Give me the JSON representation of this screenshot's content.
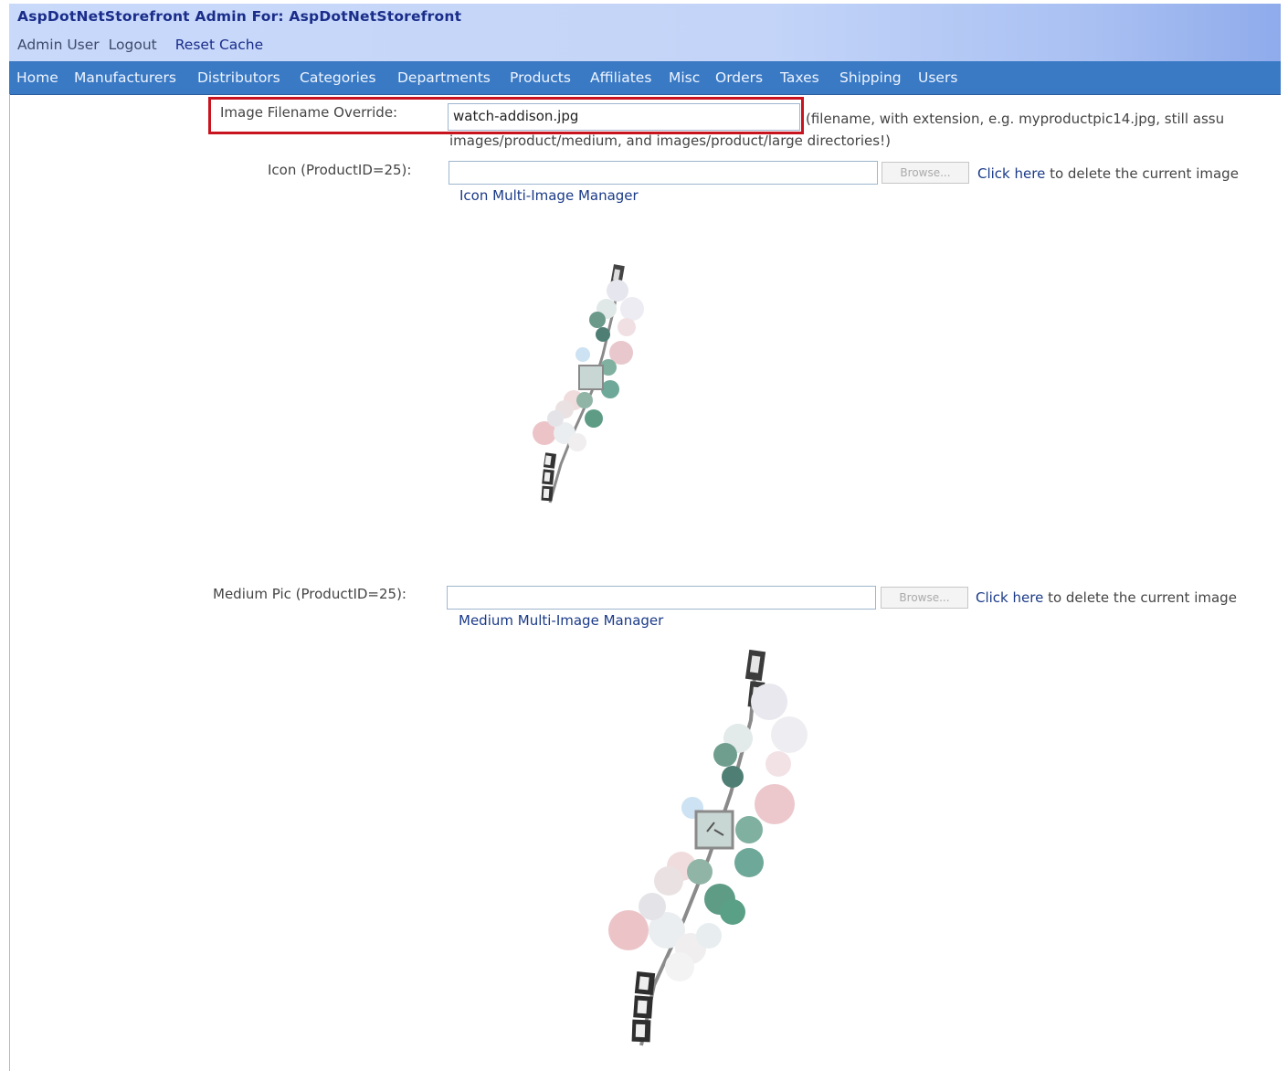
{
  "header": {
    "title": "AspDotNetStorefront Admin For: AspDotNetStorefront",
    "user": "Admin User",
    "logout": "Logout",
    "reset_cache": "Reset Cache"
  },
  "nav": [
    "Home",
    "Manufacturers",
    "Distributors",
    "Categories",
    "Departments",
    "Products",
    "Affiliates",
    "Misc",
    "Orders",
    "Taxes",
    "Shipping",
    "Users"
  ],
  "image_override": {
    "label": "Image Filename Override:",
    "value": "watch-addison.jpg",
    "hint_line1": "(filename, with extension, e.g. myproductpic14.jpg, still assu",
    "hint_line2": "images/product/medium, and images/product/large directories!)"
  },
  "icon": {
    "label": "Icon (ProductID=25):",
    "browse": "Browse...",
    "click_here": "Click here",
    "delete_text": " to delete the current image",
    "manager": "Icon Multi-Image Manager",
    "image_name": "charm-bracelet-watch-icon"
  },
  "medium": {
    "label": "Medium Pic (ProductID=25):",
    "browse": "Browse...",
    "click_here": "Click here",
    "delete_text": " to delete the current image",
    "manager": "Medium Multi-Image Manager",
    "image_name": "charm-bracelet-watch-medium"
  },
  "colors": {
    "nav_bg": "#3a7ac4",
    "header_bg": "#c3d4f8",
    "highlight": "#c8141f",
    "link": "#1a3a88"
  }
}
